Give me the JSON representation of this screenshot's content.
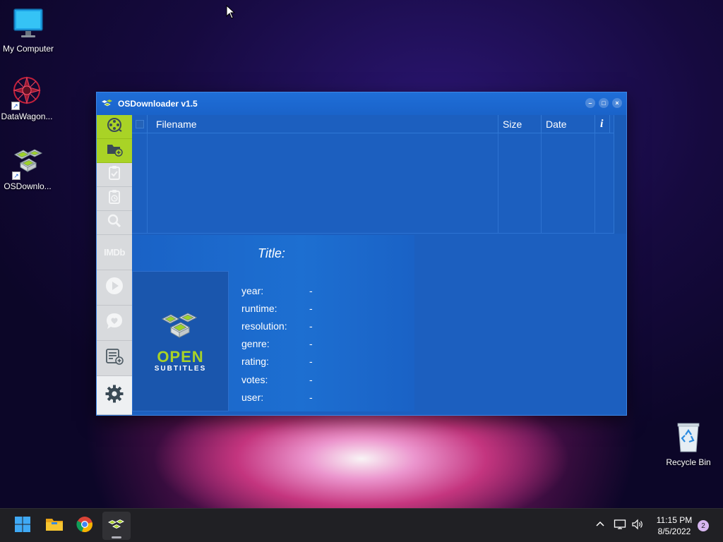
{
  "desktop": {
    "icons": [
      {
        "label": "My Computer",
        "icon": "monitor-icon"
      },
      {
        "label": "DataWagon...",
        "icon": "datawagon-icon"
      },
      {
        "label": "OSDownlo...",
        "icon": "osdownloader-icon"
      },
      {
        "label": "Recycle Bin",
        "icon": "recycle-bin-icon"
      }
    ]
  },
  "window": {
    "title": "OSDownloader v1.5",
    "controls": {
      "minimize": "–",
      "maximize": "□",
      "close": "×"
    }
  },
  "sidebar": {
    "buttons": [
      {
        "name": "film-reel-icon",
        "color": "#a9d326"
      },
      {
        "name": "add-folder-icon",
        "color": "#a9d326"
      },
      {
        "name": "clipboard-check-icon"
      },
      {
        "name": "clipboard-clock-icon"
      },
      {
        "name": "search-icon"
      },
      {
        "name": "imdb-icon",
        "text": "IMDb"
      },
      {
        "name": "play-icon"
      },
      {
        "name": "heart-chat-icon"
      },
      {
        "name": "list-add-icon"
      },
      {
        "name": "gear-icon"
      }
    ]
  },
  "grid": {
    "columns": {
      "filename": "Filename",
      "size": "Size",
      "date": "Date",
      "info": "i"
    }
  },
  "movie": {
    "title_label": "Title:",
    "rows": [
      {
        "key": "year:",
        "value": "-"
      },
      {
        "key": "runtime:",
        "value": "-"
      },
      {
        "key": "resolution:",
        "value": "-"
      },
      {
        "key": "genre:",
        "value": "-"
      },
      {
        "key": "rating:",
        "value": "-"
      },
      {
        "key": "votes:",
        "value": "-"
      },
      {
        "key": "user:",
        "value": "-"
      }
    ],
    "logo_line1": "OPEN",
    "logo_line2": "SUBTITLES"
  },
  "taskbar": {
    "apps": [
      "start-icon",
      "file-explorer-icon",
      "chrome-icon",
      "osdownloader-icon"
    ],
    "time": "11:15 PM",
    "date": "8/5/2022",
    "notification_count": "2"
  },
  "colors": {
    "accent_green": "#a9d326",
    "window_blue": "#1c5fbf"
  }
}
